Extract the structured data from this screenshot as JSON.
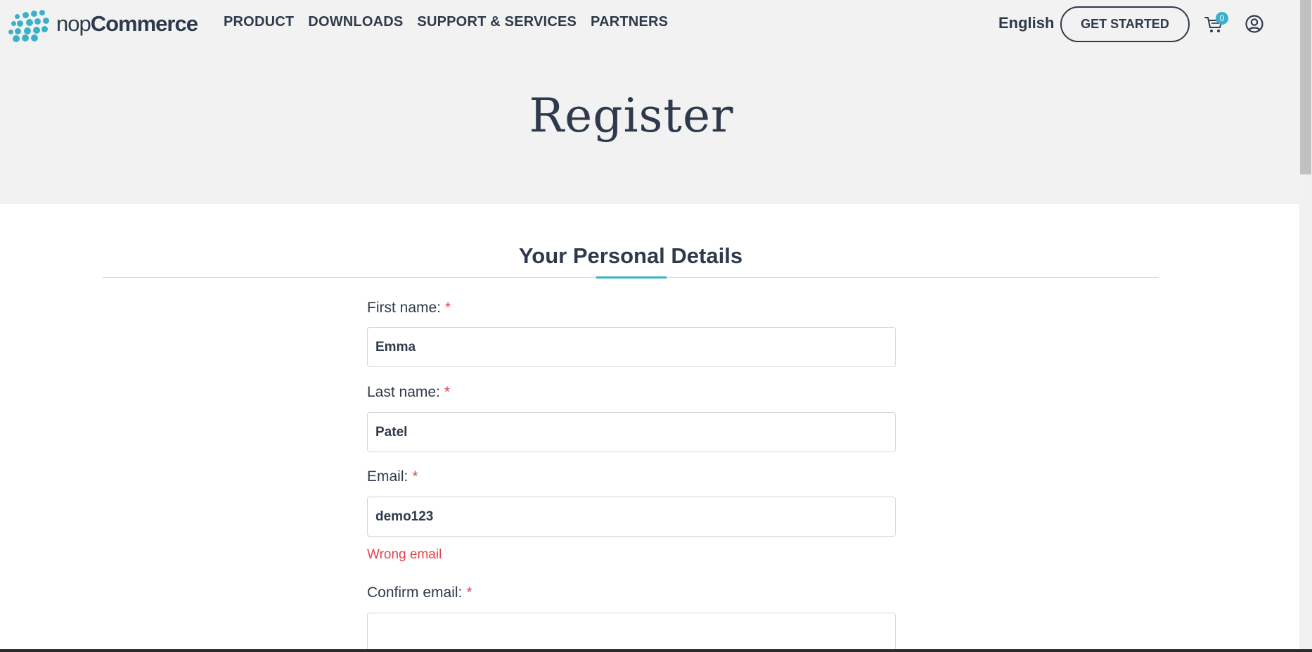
{
  "brand": {
    "name_light": "nop",
    "name_bold": "Commerce",
    "logo_color": "#3db0c9"
  },
  "nav": {
    "items": [
      "PRODUCT",
      "DOWNLOADS",
      "SUPPORT & SERVICES",
      "PARTNERS"
    ]
  },
  "header": {
    "language": "English",
    "cta_label": "GET STARTED",
    "cart_count": "0",
    "cart_icon": "cart-icon",
    "account_icon": "user-circle-icon"
  },
  "page": {
    "title": "Register"
  },
  "section": {
    "title": "Your Personal Details"
  },
  "form": {
    "required_mark": "*",
    "first_name": {
      "label": "First name:",
      "value": "Emma"
    },
    "last_name": {
      "label": "Last name:",
      "value": "Patel"
    },
    "email": {
      "label": "Email:",
      "value": "demo123",
      "error": "Wrong email"
    },
    "confirm_email": {
      "label": "Confirm email:",
      "value": ""
    }
  },
  "colors": {
    "accent": "#3db0c9",
    "text": "#2e3a4b",
    "error": "#e4434b",
    "band": "#f2f2f2"
  }
}
